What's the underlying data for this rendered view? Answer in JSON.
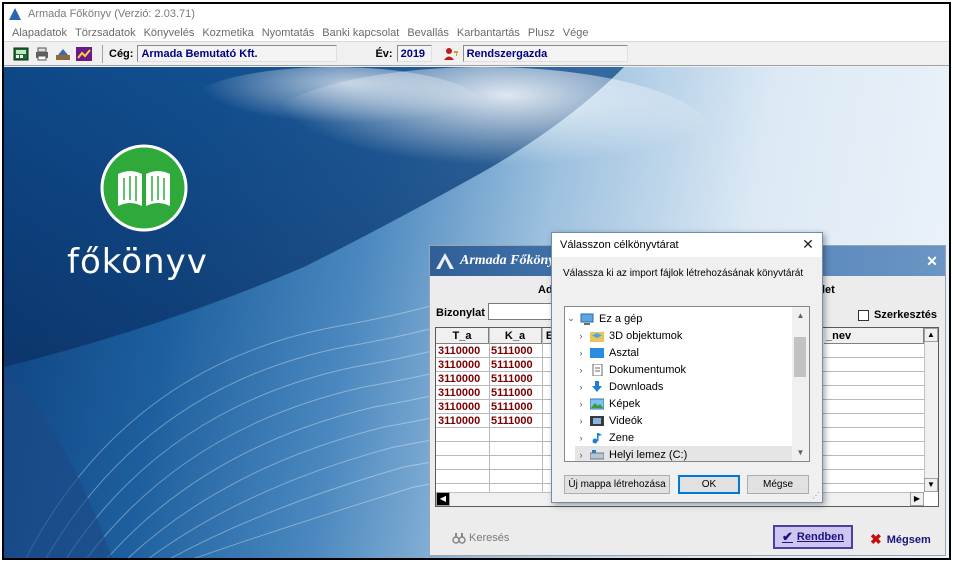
{
  "window": {
    "title": "Armada Főkönyv (Verzió: 2.03.71)"
  },
  "menu": [
    "Alapadatok",
    "Törzsadatok",
    "Könyvelés",
    "Kozmetika",
    "Nyomtatás",
    "Banki kapcsolat",
    "Bevallás",
    "Karbantartás",
    "Plusz",
    "Vége"
  ],
  "toolbar": {
    "ceg_label": "Cég:",
    "ceg_value": "Armada Bemutató Kft.",
    "ev_label": "Év:",
    "ev_value": "2019",
    "user_value": "Rendszergazda"
  },
  "logo": {
    "text": "főkönyv"
  },
  "form": {
    "title": "Armada Főkönyv",
    "tab_left": "Ad",
    "tab_right": "let",
    "bizonylat_label": "Bizonylat",
    "szerkesztes_label": "Szerkesztés",
    "columns": [
      "T_a",
      "K_a",
      "E",
      "_nev"
    ],
    "rows": [
      [
        "3110000",
        "5111000"
      ],
      [
        "3110000",
        "5111000"
      ],
      [
        "3110000",
        "5111000"
      ],
      [
        "3110000",
        "5111000"
      ],
      [
        "3110000",
        "5111000"
      ],
      [
        "3110000",
        "5111000"
      ]
    ],
    "kereses_label": "Keresés",
    "rendben_label": "Rendben",
    "megsem_label": "Mégsem"
  },
  "dialog": {
    "title": "Válasszon célkönyvtárat",
    "instruction": "Válassza ki az import fájlok létrehozásának könyvtárát",
    "tree": [
      {
        "label": "Ez a gép",
        "level": 0,
        "expanded": true,
        "icon": "computer-icon"
      },
      {
        "label": "3D objektumok",
        "level": 1,
        "icon": "3d-objects-icon"
      },
      {
        "label": "Asztal",
        "level": 1,
        "icon": "desktop-icon"
      },
      {
        "label": "Dokumentumok",
        "level": 1,
        "icon": "documents-icon"
      },
      {
        "label": "Downloads",
        "level": 1,
        "icon": "downloads-icon"
      },
      {
        "label": "Képek",
        "level": 1,
        "icon": "pictures-icon"
      },
      {
        "label": "Videók",
        "level": 1,
        "icon": "videos-icon"
      },
      {
        "label": "Zene",
        "level": 1,
        "icon": "music-icon"
      },
      {
        "label": "Helyi lemez (C:)",
        "level": 1,
        "icon": "drive-icon",
        "selected": true
      }
    ],
    "new_folder_label": "Új mappa létrehozása",
    "ok_label": "OK",
    "cancel_label": "Mégse"
  }
}
